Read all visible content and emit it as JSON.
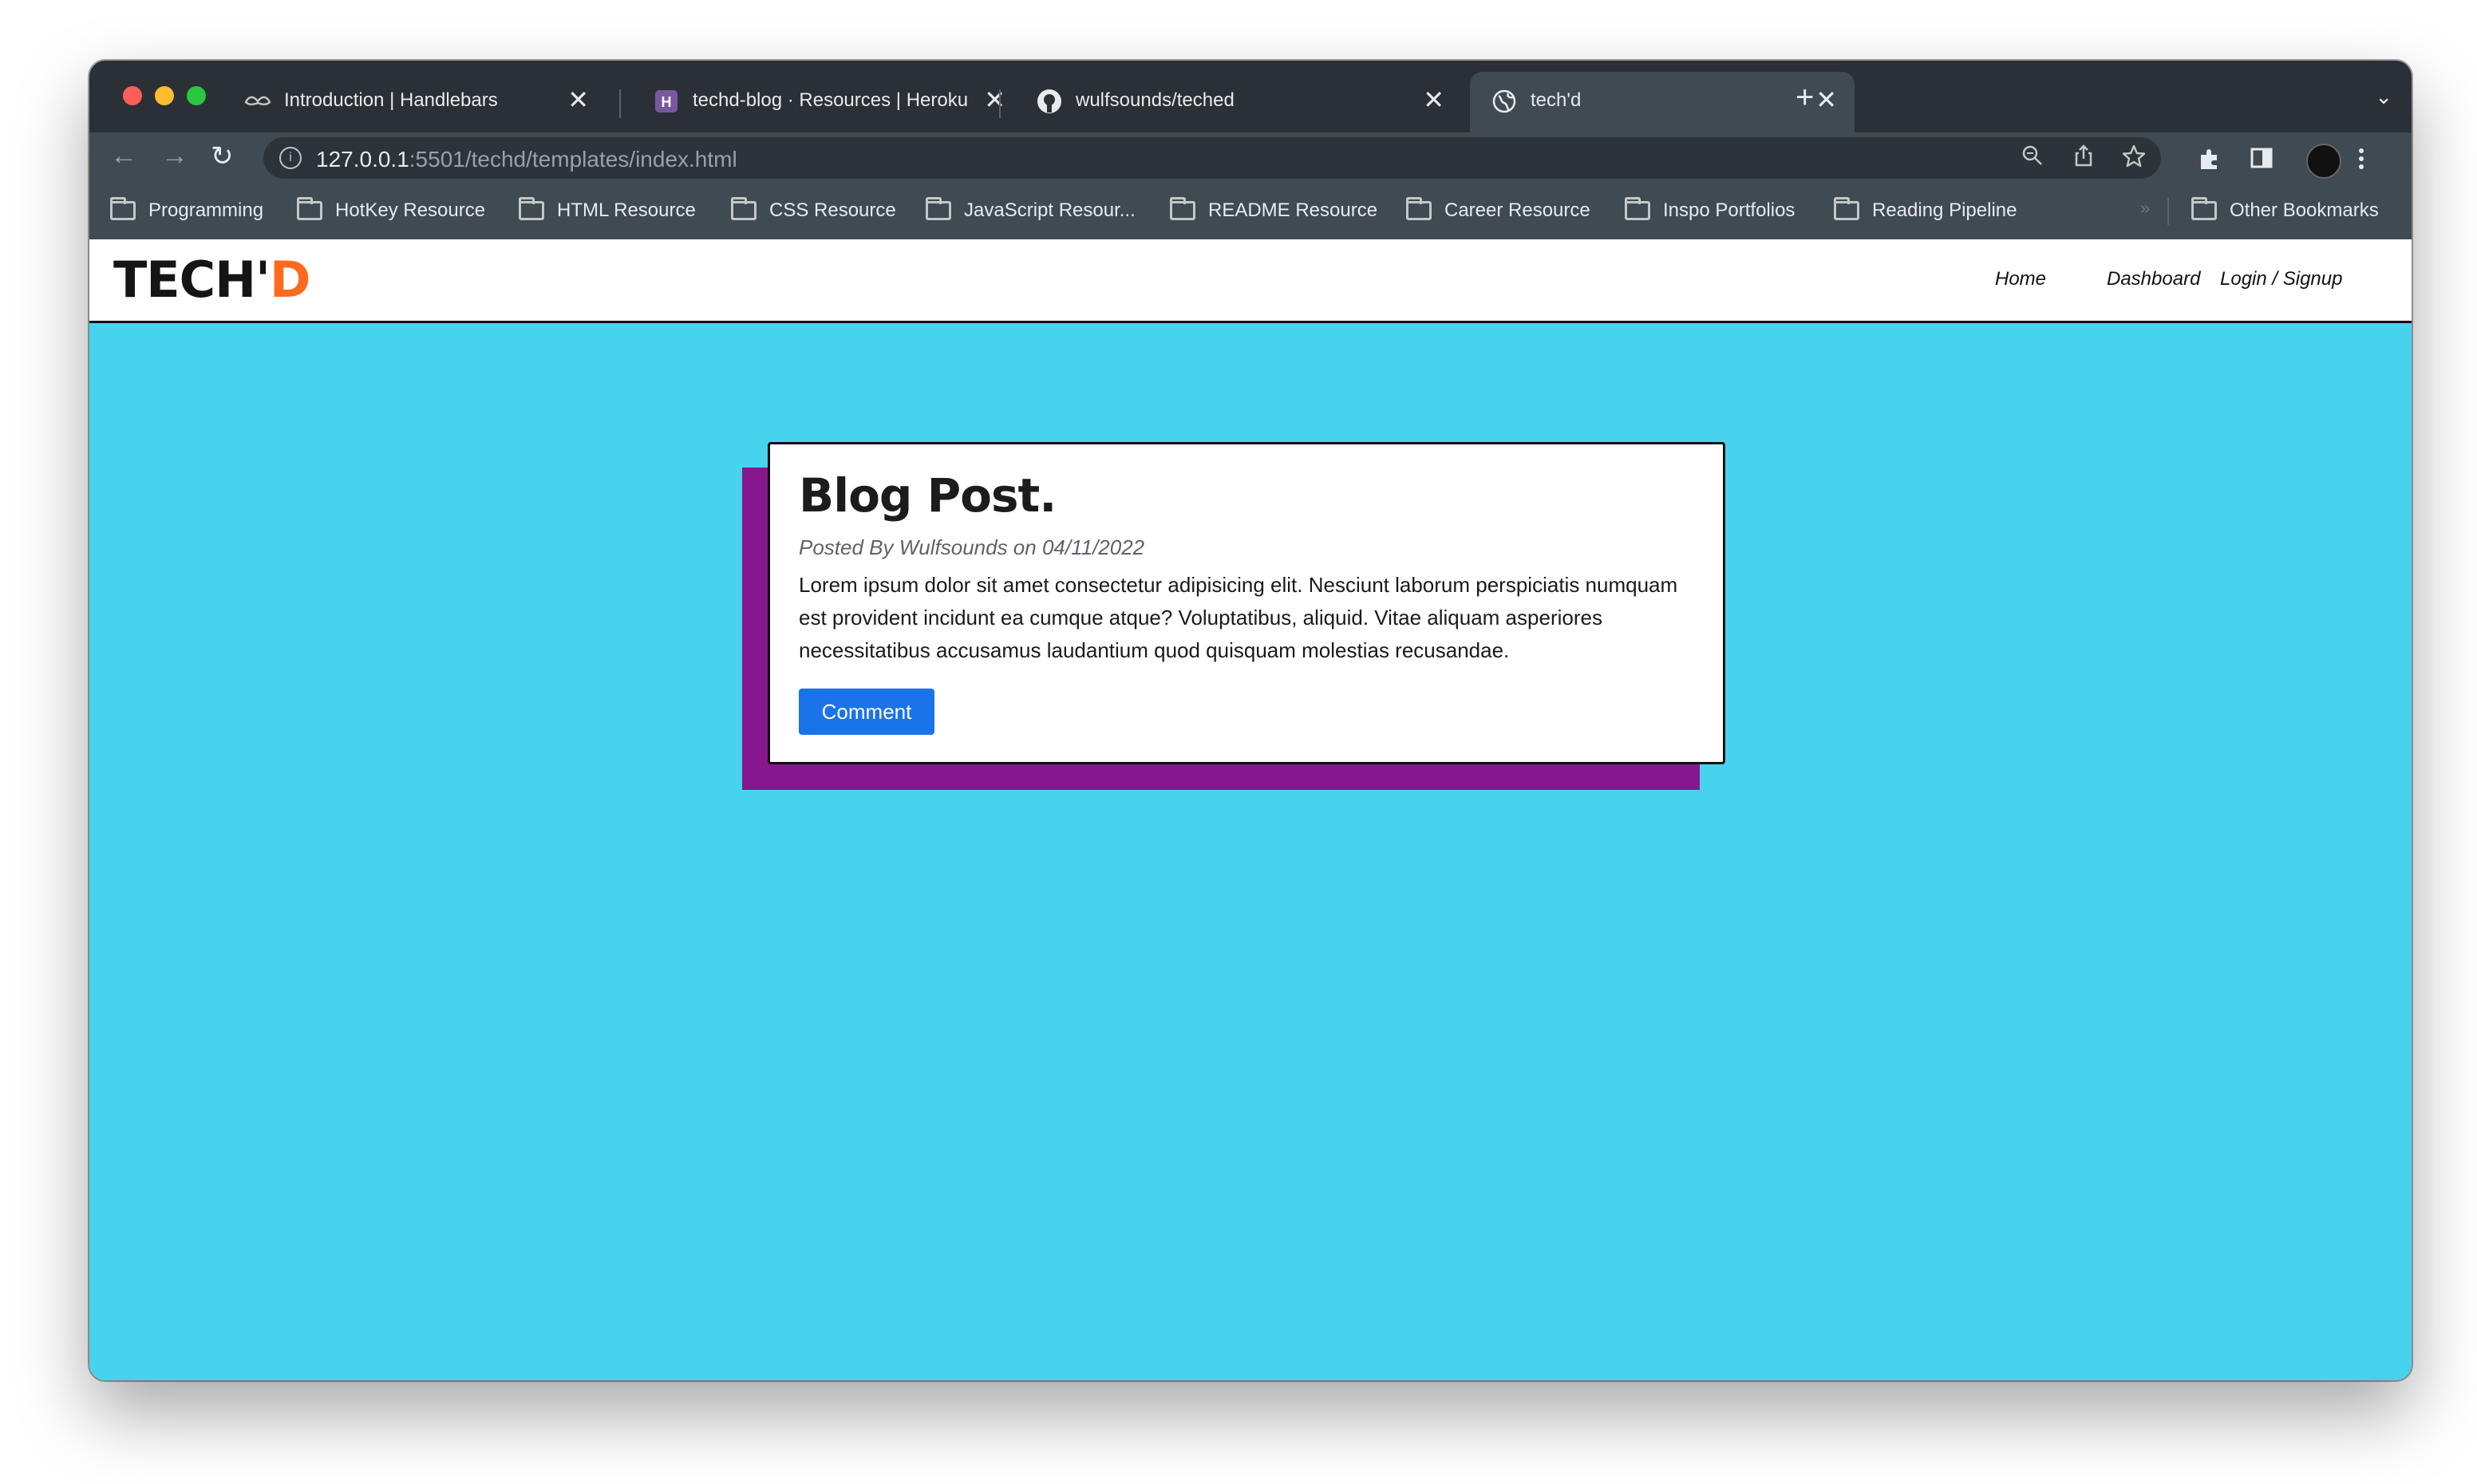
{
  "browser": {
    "tabs": [
      {
        "title": "Introduction | Handlebars",
        "favicon": "handlebars-mustache-icon"
      },
      {
        "title": "techd-blog · Resources | Heroku",
        "favicon": "heroku-icon"
      },
      {
        "title": "wulfsounds/teched",
        "favicon": "github-icon"
      },
      {
        "title": "tech'd",
        "favicon": "globe-icon",
        "active": true
      }
    ],
    "close_glyph": "✕",
    "new_tab_glyph": "+",
    "address": {
      "host": "127.0.0.1",
      "path": ":5501/techd/templates/index.html"
    },
    "bookmarks": [
      "Programming",
      "HotKey Resource",
      "HTML Resource",
      "CSS Resource",
      "JavaScript Resour...",
      "README Resource",
      "Career Resource",
      "Inspo Portfolios",
      "Reading Pipeline"
    ],
    "other_bookmarks": "Other Bookmarks",
    "more_glyph": "»"
  },
  "site": {
    "logo": {
      "main": "TECH'",
      "accent": "D",
      "accent_color": "#ff6a1f"
    },
    "nav": [
      "Home",
      "Dashboard",
      "Login / Signup"
    ],
    "background": "#47d3ee"
  },
  "post": {
    "title": "Blog Post.",
    "meta": "Posted By Wulfsounds on 04/11/2022",
    "body": "Lorem ipsum dolor sit amet consectetur adipisicing elit. Nesciunt laborum perspiciatis numquam est provident incidunt ea cumque atque? Voluptatibus, aliquid. Vitae aliquam asperiores necessitatibus accusamus laudantium quod quisquam molestias recusandae.",
    "button": "Comment",
    "shadow_color": "#86178d",
    "button_color": "#1a73e8"
  }
}
